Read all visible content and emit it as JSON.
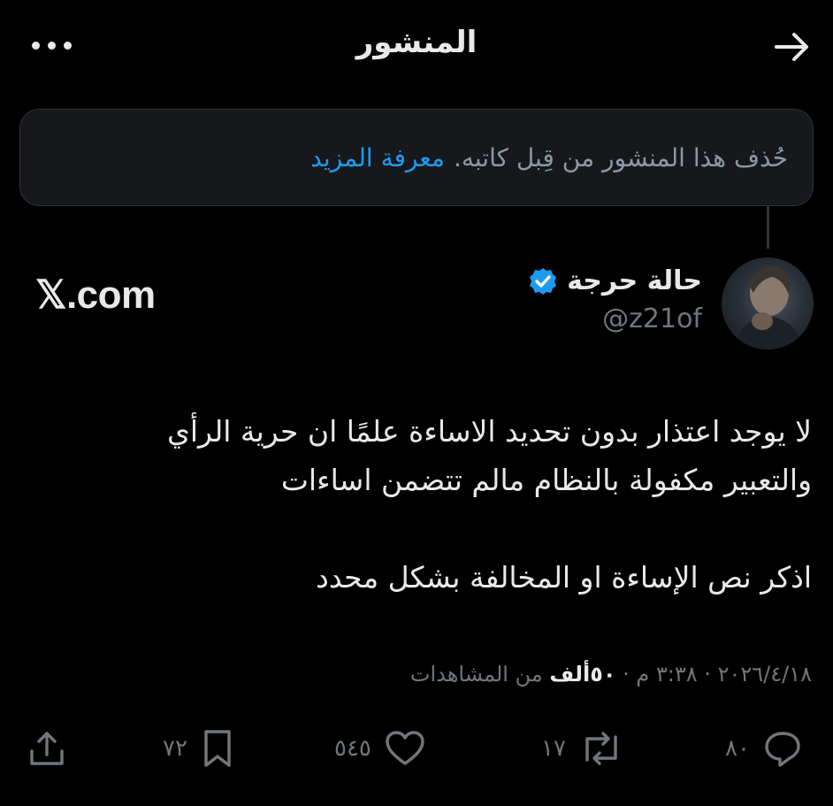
{
  "header": {
    "title": "المنشور"
  },
  "notice": {
    "text": "حُذف هذا المنشور من قِبل كاتبه.",
    "learn_more": "معرفة المزيد"
  },
  "author": {
    "name": "حالة حرجة",
    "handle": "@z21of"
  },
  "watermark": "𝕏.com",
  "post": {
    "line1": "لا يوجد اعتذار بدون تحديد الاساءة علمًا ان حرية الرأي",
    "line2": "والتعبير مكفولة بالنظام مالم تتضمن اساءات",
    "line3": "اذكر نص الإساءة او المخالفة بشكل محدد"
  },
  "meta": {
    "date": "٢٠٢٦/٤/١٨",
    "sep": "·",
    "time": "٣:٣٨ م",
    "views_count": "٥٠ألف",
    "views_label": "من المشاهدات"
  },
  "actions": {
    "replies": "٨٠",
    "reposts": "١٧",
    "likes": "٥٤٥",
    "bookmarks": "٧٢"
  },
  "colors": {
    "background": "#000000",
    "accent": "#1d9bf0",
    "muted": "#71767b",
    "text": "#e7e9ea"
  }
}
